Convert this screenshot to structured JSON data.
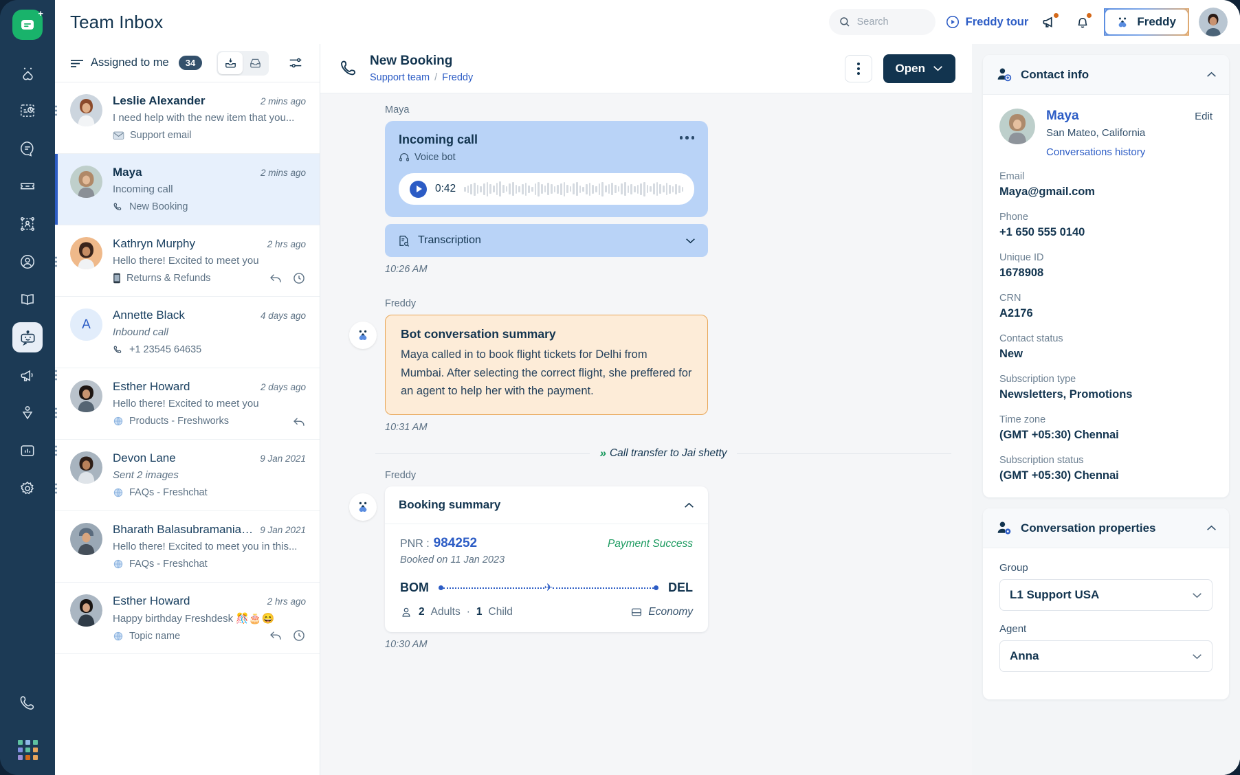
{
  "topbar": {
    "title": "Team Inbox",
    "search_placeholder": "Search",
    "freddy_tour": "Freddy tour",
    "freddy_pill": "Freddy",
    "icons": [
      "search-icon",
      "play-circle-icon",
      "megaphone-icon",
      "bell-icon",
      "freddy-icon",
      "user-avatar"
    ]
  },
  "rail": {
    "items": [
      {
        "name": "freddy-copilot-icon"
      },
      {
        "name": "dashboard-icon"
      },
      {
        "name": "conversations-icon"
      },
      {
        "name": "tickets-icon"
      },
      {
        "name": "customer-journey-icon"
      },
      {
        "name": "contacts-icon"
      },
      {
        "name": "knowledge-base-icon"
      },
      {
        "name": "bots-icon"
      },
      {
        "name": "campaigns-icon"
      },
      {
        "name": "leads-icon"
      },
      {
        "name": "analytics-icon"
      },
      {
        "name": "settings-icon"
      },
      {
        "name": "phone-icon"
      },
      {
        "name": "apps-grid-icon"
      }
    ]
  },
  "conversations": {
    "header": {
      "title": "Assigned to me",
      "count": "34",
      "view_open_label": "open-inbox-view",
      "view_all_label": "all-inbox-view",
      "filter_label": "filter-settings"
    },
    "items": [
      {
        "name": "Leslie Alexander",
        "time": "2 mins ago",
        "preview": "I need help with the new item that you...",
        "preview_italic": false,
        "channel": "Support email",
        "channel_icon": "email-icon",
        "selected": false,
        "avatar_type": "photo",
        "actions": []
      },
      {
        "name": "Maya",
        "time": "2 mins ago",
        "preview": "Incoming call",
        "preview_italic": false,
        "channel": "New Booking",
        "channel_icon": "phone-icon",
        "selected": true,
        "avatar_type": "photo",
        "actions": []
      },
      {
        "name": "Kathryn Murphy",
        "time": "2 hrs ago",
        "preview": "Hello there! Excited to meet you",
        "preview_italic": false,
        "channel": "Returns & Refunds",
        "channel_icon": "mobile-icon",
        "selected": false,
        "avatar_type": "photo",
        "actions": [
          "reply-icon",
          "clock-icon"
        ]
      },
      {
        "name": "Annette Black",
        "time": "4 days ago",
        "preview": "Inbound call",
        "preview_italic": true,
        "channel": "+1 23545 64635",
        "channel_icon": "phone-icon",
        "selected": false,
        "avatar_type": "letter",
        "avatar_letter": "A",
        "actions": []
      },
      {
        "name": "Esther Howard",
        "time": "2 days ago",
        "preview": "Hello there! Excited to meet you",
        "preview_italic": false,
        "channel": "Products - Freshworks",
        "channel_icon": "globe-icon",
        "selected": false,
        "avatar_type": "photo",
        "actions": [
          "reply-icon"
        ]
      },
      {
        "name": "Devon Lane",
        "time": "9 Jan 2021",
        "preview": "Sent 2 images",
        "preview_italic": true,
        "channel": "FAQs - Freshchat",
        "channel_icon": "globe-icon",
        "selected": false,
        "avatar_type": "photo",
        "actions": []
      },
      {
        "name": "Bharath Balasubramaniam...",
        "time": "9 Jan 2021",
        "preview": "Hello there! Excited to meet you in this...",
        "preview_italic": false,
        "channel": "FAQs - Freshchat",
        "channel_icon": "globe-icon",
        "selected": false,
        "avatar_type": "photo",
        "actions": []
      },
      {
        "name": "Esther Howard",
        "time": "2 hrs ago",
        "preview": "Happy birthday Freshdesk 🎊🎂😄",
        "preview_italic": false,
        "channel": "Topic name",
        "channel_icon": "globe-icon",
        "selected": false,
        "avatar_type": "photo",
        "actions": [
          "reply-icon",
          "clock-icon"
        ]
      }
    ]
  },
  "chat": {
    "title": "New Booking",
    "breadcrumb_team": "Support team",
    "breadcrumb_sep": "/",
    "breadcrumb_bot": "Freddy",
    "status_button": "Open",
    "messages": {
      "maya_label": "Maya",
      "call_title": "Incoming call",
      "call_source": "Voice bot",
      "call_duration": "0:42",
      "transcription_label": "Transcription",
      "call_time": "10:26 AM",
      "freddy_label": "Freddy",
      "summary_title": "Bot conversation summary",
      "summary_body": "Maya called in to book flight tickets for Delhi from Mumbai. After selecting the correct flight, she preffered for an agent to help her with the payment.",
      "summary_time": "10:31 AM",
      "transfer_note": "Call transfer to Jai shetty",
      "freddy_label2": "Freddy",
      "booking_title": "Booking summary",
      "pnr_label": "PNR :",
      "pnr_value": "984252",
      "payment_status": "Payment Success",
      "booked_on": "Booked on 11 Jan 2023",
      "origin": "BOM",
      "destination": "DEL",
      "passengers_adults": "2",
      "passengers_adults_label": "Adults",
      "passengers_sep": "·",
      "passengers_children": "1",
      "passengers_children_label": "Child",
      "cabin_class": "Economy",
      "booking_time": "10:30 AM"
    }
  },
  "contact_info": {
    "panel_title": "Contact info",
    "name": "Maya",
    "location": "San Mateo, California",
    "edit_label": "Edit",
    "history_link": "Conversations history",
    "fields": [
      {
        "label": "Email",
        "value": "Maya@gmail.com"
      },
      {
        "label": "Phone",
        "value": "+1 650 555 0140"
      },
      {
        "label": "Unique ID",
        "value": "1678908"
      },
      {
        "label": "CRN",
        "value": "A2176"
      },
      {
        "label": "Contact status",
        "value": "New"
      },
      {
        "label": "Subscription type",
        "value": "Newsletters, Promotions"
      },
      {
        "label": "Time zone",
        "value": "(GMT +05:30) Chennai"
      },
      {
        "label": "Subscription status",
        "value": "(GMT +05:30) Chennai"
      }
    ]
  },
  "conversation_properties": {
    "panel_title": "Conversation properties",
    "fields": [
      {
        "label": "Group",
        "value": "L1 Support USA"
      },
      {
        "label": "Agent",
        "value": "Anna"
      }
    ]
  },
  "colors": {
    "rail_bg": "#1c3a55",
    "accent_blue": "#2c5cc5",
    "selected_row": "#e7f0fc",
    "call_card": "#b9d3f7",
    "summary_card": "#fdecd8",
    "summary_border": "#e8a657",
    "success_green": "#1b9a5f",
    "logo_green": "#19b36b"
  }
}
